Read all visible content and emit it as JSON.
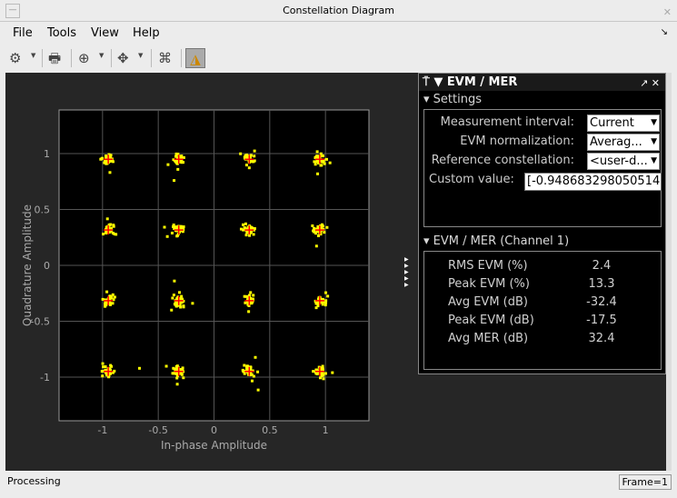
{
  "window": {
    "title": "Constellation Diagram",
    "minimize": "—",
    "close": "✕"
  },
  "menu": {
    "items": [
      "File",
      "Tools",
      "View",
      "Help"
    ],
    "overflow": "↘"
  },
  "toolbar": {
    "icons": [
      "gear-icon",
      "print-icon",
      "zoom-in-icon",
      "fit-icon",
      "constellation-icon",
      "measurements-icon"
    ]
  },
  "panel": {
    "title": "EVM / MER",
    "settings": {
      "title": "Settings",
      "measurement_interval": {
        "label": "Measurement interval:",
        "value": "Current"
      },
      "evm_normalization": {
        "label": "EVM normalization:",
        "value": "Averag..."
      },
      "reference_constellation": {
        "label": "Reference constellation:",
        "value": "<user-d..."
      },
      "custom_value": {
        "label": "Custom value:",
        "value": "[-0.948683298050514"
      }
    },
    "results": {
      "title": "EVM / MER (Channel 1)",
      "rows": [
        {
          "k": "RMS EVM (%)",
          "v": "2.4"
        },
        {
          "k": "Peak EVM (%)",
          "v": "13.3"
        },
        {
          "k": "Avg EVM (dB)",
          "v": "-32.4"
        },
        {
          "k": "Peak EVM (dB)",
          "v": "-17.5"
        },
        {
          "k": "Avg MER (dB)",
          "v": "32.4"
        }
      ]
    }
  },
  "status": {
    "text": "Processing",
    "frame": "Frame=1"
  },
  "colors": {
    "symbols": "#ffff00",
    "reference": "#ff0000",
    "grid": "#555555",
    "plot_bg": "#000000"
  },
  "chart_data": {
    "type": "scatter",
    "xlabel": "In-phase Amplitude",
    "ylabel": "Quadrature Amplitude",
    "xlim": [
      -1.39,
      1.39
    ],
    "ylim": [
      -1.39,
      1.39
    ],
    "xticks": [
      "-1",
      "-0.5",
      "0",
      "0.5",
      "1"
    ],
    "xtick_values": [
      -1,
      -0.5,
      0,
      0.5,
      1
    ],
    "yticks": [
      "1",
      "0.5",
      "0",
      "-0.5",
      "-1"
    ],
    "ytick_values": [
      1,
      0.5,
      0,
      -0.5,
      -1
    ],
    "grid": true,
    "reference_levels": [
      -0.9487,
      -0.3162,
      0.3162,
      0.9487
    ],
    "rms_evm_percent": 2.4
  }
}
